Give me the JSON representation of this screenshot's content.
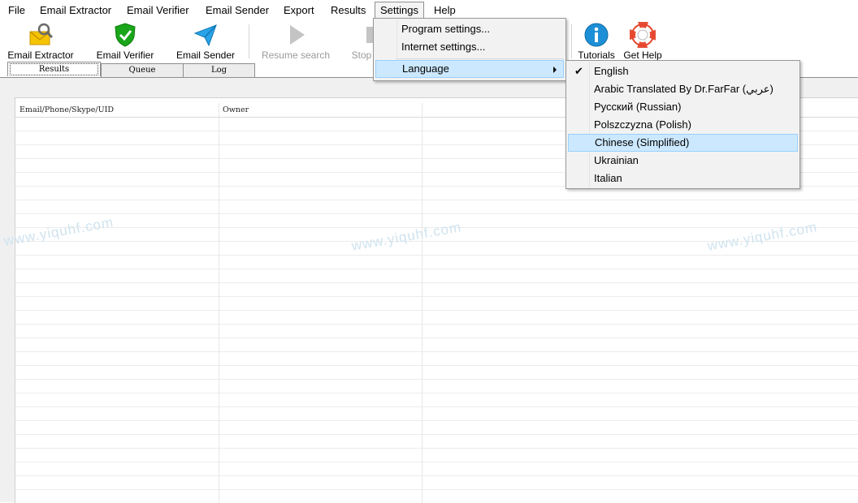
{
  "menubar": {
    "items": [
      "File",
      "Email Extractor",
      "Email Verifier",
      "Email Sender",
      "Export",
      "Results",
      "Settings",
      "Help"
    ]
  },
  "toolbar": {
    "email_extractor": "Email Extractor",
    "email_verifier": "Email Verifier",
    "email_sender": "Email Sender",
    "resume_search": "Resume search",
    "stop": "Stop",
    "tutorials": "Tutorials",
    "get_help": "Get Help"
  },
  "tabs": [
    "Results",
    "Queue",
    "Log"
  ],
  "grid": {
    "columns": [
      "Email/Phone/Skype/UID",
      "Owner"
    ]
  },
  "watermark": "www.yiquhf.com",
  "settings_menu": {
    "items": [
      "Program settings...",
      "Internet settings...",
      "Language"
    ]
  },
  "language_menu": {
    "checked": "English",
    "highlighted": "Chinese (Simplified)",
    "items": [
      "English",
      "Arabic Translated By Dr.FarFar (عربي)",
      "Русский (Russian)",
      "Polszczyzna (Polish)",
      "Chinese (Simplified)",
      "Ukrainian",
      "Italian"
    ]
  },
  "colors": {
    "menu_highlight": "#cce8ff",
    "extractor_icon": "#f5c400",
    "verifier_icon": "#1aa51a",
    "sender_icon": "#2aa3e8",
    "tutorials_icon": "#1d8fd6",
    "help_icon": "#e5452b"
  }
}
